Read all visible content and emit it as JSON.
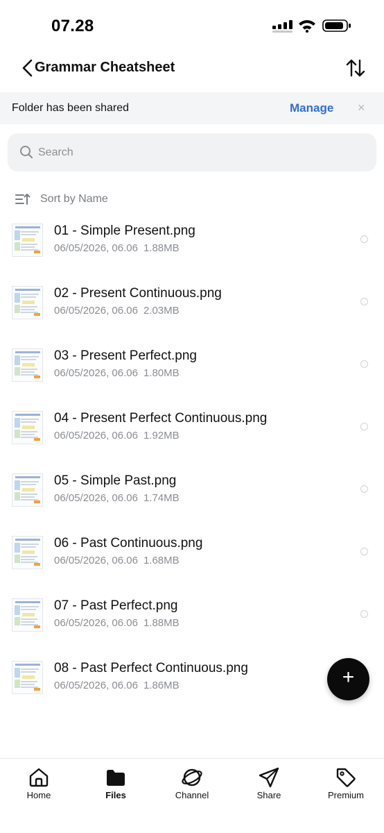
{
  "status_bar": {
    "time": "07.28"
  },
  "nav": {
    "title": "Grammar Cheatsheet"
  },
  "banner": {
    "text": "Folder has been shared",
    "action": "Manage",
    "close": "×"
  },
  "search": {
    "placeholder": "Search"
  },
  "sort": {
    "label": "Sort by Name"
  },
  "files": [
    {
      "name": "01 - Simple Present.png",
      "date": "06/05/2026, 06.06",
      "size": "1.88MB"
    },
    {
      "name": "02 - Present Continuous.png",
      "date": "06/05/2026, 06.06",
      "size": "2.03MB"
    },
    {
      "name": "03 - Present Perfect.png",
      "date": "06/05/2026, 06.06",
      "size": "1.80MB"
    },
    {
      "name": "04 - Present Perfect Continuous.png",
      "date": "06/05/2026, 06.06",
      "size": "1.92MB"
    },
    {
      "name": "05 - Simple Past.png",
      "date": "06/05/2026, 06.06",
      "size": "1.74MB"
    },
    {
      "name": "06 - Past Continuous.png",
      "date": "06/05/2026, 06.06",
      "size": "1.68MB"
    },
    {
      "name": "07 - Past Perfect.png",
      "date": "06/05/2026, 06.06",
      "size": "1.88MB"
    },
    {
      "name": "08 - Past Perfect Continuous.png",
      "date": "06/05/2026, 06.06",
      "size": "1.86MB"
    }
  ],
  "fab": {
    "label": "+"
  },
  "tabs": [
    {
      "label": "Home",
      "icon": "home-icon",
      "active": false
    },
    {
      "label": "Files",
      "icon": "folder-icon",
      "active": true
    },
    {
      "label": "Channel",
      "icon": "planet-icon",
      "active": false
    },
    {
      "label": "Share",
      "icon": "paper-plane-icon",
      "active": false
    },
    {
      "label": "Premium",
      "icon": "tag-icon",
      "active": false
    }
  ],
  "colors": {
    "accent": "#2f6fd6",
    "banner_bg": "#f4f5f7",
    "fab": "#0b0b0b"
  }
}
